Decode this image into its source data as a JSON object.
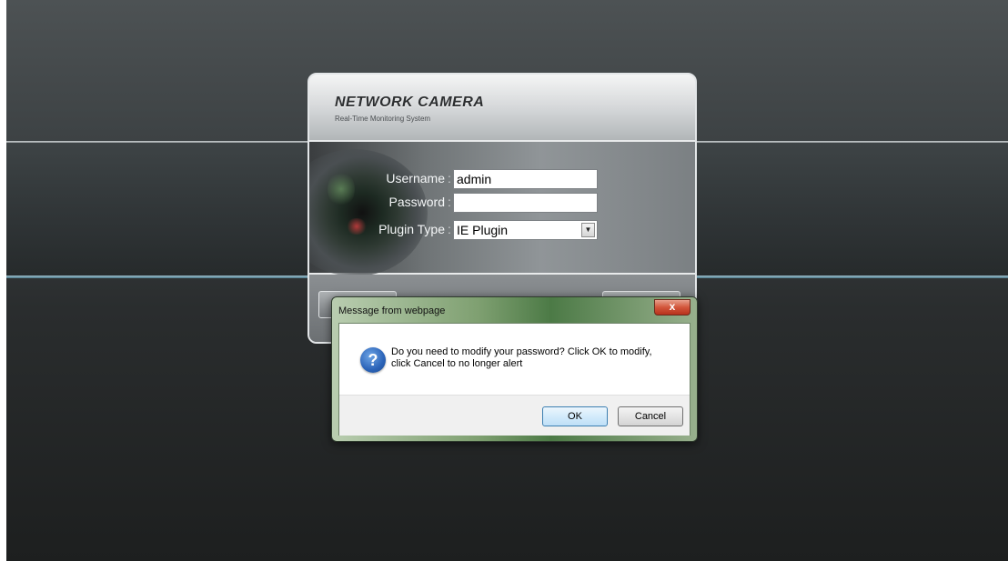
{
  "login": {
    "brand_title": "NETWORK CAMERA",
    "brand_subtitle": "Real-Time Monitoring System",
    "username_label": "Username",
    "username_value": "admin",
    "password_label": "Password",
    "password_value": "",
    "plugin_label": "Plugin Type",
    "plugin_value": "IE Plugin",
    "separator": ":"
  },
  "dialog": {
    "title": "Message from webpage",
    "close_glyph": "x",
    "icon_glyph": "?",
    "message": "Do you need to modify your password? Click OK to modify, click Cancel to no longer alert",
    "ok_label": "OK",
    "cancel_label": "Cancel"
  }
}
